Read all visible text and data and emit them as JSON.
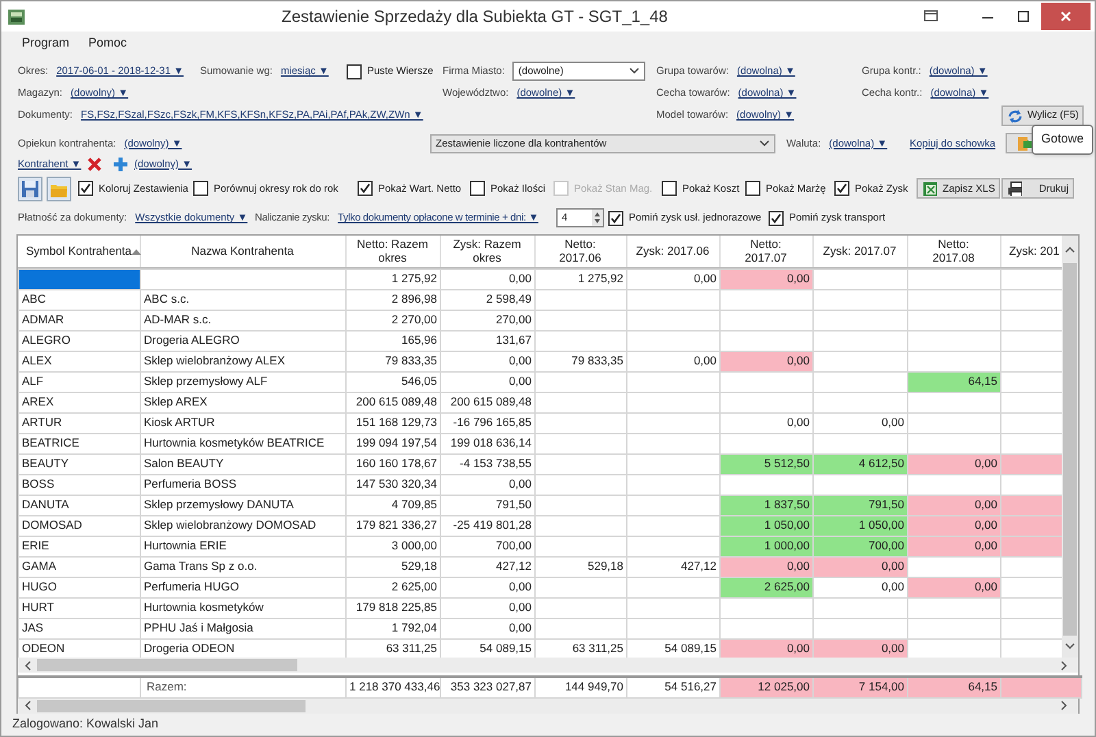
{
  "window": {
    "title": "Zestawienie Sprzedaży dla Subiekta GT - SGT_1_48"
  },
  "menu": [
    {
      "label": "Program"
    },
    {
      "label": "Pomoc"
    }
  ],
  "filter_rows": [
    {
      "items": [
        {
          "kind": "dropdown",
          "label": "Okres:",
          "value": "2017-06-01 - 2018-12-31 ▼"
        },
        {
          "kind": "dropdown",
          "label": "Sumowanie wg:",
          "value": "miesiąc ▼"
        },
        {
          "kind": "checkbox",
          "label": "Puste Wiersze",
          "checked": false
        },
        {
          "kind": "select",
          "label": "Firma Miasto:",
          "value": "(dowolne)"
        },
        {
          "kind": "dropdown",
          "label": "Grupa towarów:",
          "value": "(dowolna) ▼"
        },
        {
          "kind": "dropdown",
          "label": "Grupa kontr.:",
          "value": "(dowolna) ▼"
        }
      ]
    },
    {
      "items": [
        {
          "kind": "dropdown",
          "label": "Magazyn:",
          "value": "(dowolny) ▼"
        },
        {
          "kind": "dropdown",
          "label": "Województwo:",
          "value": "(dowolne) ▼"
        },
        {
          "kind": "dropdown",
          "label": "Cecha towarów:",
          "value": "(dowolna) ▼"
        },
        {
          "kind": "dropdown",
          "label": "Cecha kontr.:",
          "value": "(dowolna) ▼"
        }
      ]
    },
    {
      "items": [
        {
          "kind": "dropdown",
          "label": "Dokumenty:",
          "value": "FS,FSz,FSzal,FSzc,FSzk,FM,KFS,KFSn,KFSz,PA,PAi,PAf,PAk,ZW,ZWn ▼"
        },
        {
          "kind": "dropdown",
          "label": "Model towarów:",
          "value": "(dowolny) ▼"
        },
        {
          "kind": "button",
          "label": "Wylicz (F5)"
        }
      ]
    },
    {
      "items": [
        {
          "kind": "dropdown",
          "label": "Opiekun kontrahenta:",
          "value": "(dowolny) ▼"
        },
        {
          "kind": "select",
          "value": "Zestawienie liczone dla kontrahentów"
        },
        {
          "kind": "dropdown",
          "label": "Waluta:",
          "value": "(dowolna) ▼"
        },
        {
          "kind": "link",
          "value": "Kopiuj do schowka"
        },
        {
          "kind": "icon-button"
        }
      ]
    },
    {
      "items": [
        {
          "kind": "link",
          "value": "Kontrahent ▼"
        },
        {
          "kind": "icon-button"
        },
        {
          "kind": "icon-button"
        },
        {
          "kind": "link",
          "value": "(dowolny) ▼"
        }
      ]
    },
    {
      "items": [
        {
          "kind": "icon-button"
        },
        {
          "kind": "icon-button"
        },
        {
          "kind": "checkbox",
          "label": "Koloruj Zestawienia",
          "checked": true
        },
        {
          "kind": "checkbox",
          "label": "Porównuj okresy rok do rok",
          "checked": false
        },
        {
          "kind": "checkbox",
          "label": "Pokaż Wart. Netto",
          "checked": true
        },
        {
          "kind": "checkbox",
          "label": "Pokaż Ilości",
          "checked": false
        },
        {
          "kind": "checkbox",
          "label": "Pokaż Stan Mag.",
          "checked": false,
          "disabled": true
        },
        {
          "kind": "checkbox",
          "label": "Pokaż Koszt",
          "checked": false
        },
        {
          "kind": "checkbox",
          "label": "Pokaż Marżę",
          "checked": false
        },
        {
          "kind": "checkbox",
          "label": "Pokaż Zysk",
          "checked": true
        },
        {
          "kind": "button",
          "label": "Zapisz XLS"
        },
        {
          "kind": "button",
          "label": "Drukuj"
        }
      ]
    },
    {
      "items": [
        {
          "kind": "dropdown",
          "label": "Płatność za dokumenty:",
          "value": "Wszystkie dokumenty ▼"
        },
        {
          "kind": "dropdown",
          "label": "Naliczanie zysku:",
          "value": "Tylko dokumenty opłacone w terminie + dni: ▼"
        },
        {
          "kind": "spinner",
          "value": "4"
        },
        {
          "kind": "checkbox",
          "label": "Pomiń zysk usł. jednorazowe",
          "checked": true
        },
        {
          "kind": "checkbox",
          "label": "Pomiń zysk transport",
          "checked": true
        }
      ]
    }
  ],
  "tooltip": {
    "text": "Gotowe"
  },
  "table": {
    "columns": [
      {
        "label": "Symbol Kontrahenta",
        "sorted": true
      },
      {
        "label": "Nazwa Kontrahenta"
      },
      {
        "label": "Netto: Razem okres"
      },
      {
        "label": "Zysk: Razem okres"
      },
      {
        "label": "Netto: 2017.06"
      },
      {
        "label": "Zysk: 2017.06"
      },
      {
        "label": "Netto: 2017.07"
      },
      {
        "label": "Zysk: 2017.07"
      },
      {
        "label": "Netto: 2017.08"
      },
      {
        "label": "Zysk: 201"
      }
    ],
    "rows": [
      {
        "selected": true,
        "cells": [
          null,
          null,
          "1 275,92",
          "0,00",
          "1 275,92",
          "0,00",
          {
            "text": "0,00",
            "color": "#f9b6c0"
          },
          null,
          null,
          null
        ]
      },
      {
        "selected": false,
        "cells": [
          "ABC",
          "ABC s.c.",
          "2 896,98",
          "2 598,49",
          null,
          null,
          null,
          null,
          null,
          null
        ]
      },
      {
        "selected": false,
        "cells": [
          "ADMAR",
          "AD-MAR s.c.",
          "2 270,00",
          "270,00",
          null,
          null,
          null,
          null,
          null,
          null
        ]
      },
      {
        "selected": false,
        "cells": [
          "ALEGRO",
          "Drogeria ALEGRO",
          "165,96",
          "131,67",
          null,
          null,
          null,
          null,
          null,
          null
        ]
      },
      {
        "selected": false,
        "cells": [
          "ALEX",
          "Sklep wielobranżowy  ALEX",
          "79 833,35",
          "0,00",
          "79 833,35",
          "0,00",
          {
            "text": "0,00",
            "color": "#f9b6c0"
          },
          null,
          null,
          null
        ]
      },
      {
        "selected": false,
        "cells": [
          "ALF",
          "Sklep przemysłowy ALF",
          "546,05",
          "0,00",
          null,
          null,
          null,
          null,
          {
            "text": "64,15",
            "color": "#8fe38a"
          },
          null
        ]
      },
      {
        "selected": false,
        "cells": [
          "AREX",
          "Sklep AREX",
          "200 615 089,48",
          "200 615 089,48",
          null,
          null,
          null,
          null,
          null,
          null
        ]
      },
      {
        "selected": false,
        "cells": [
          "ARTUR",
          "Kiosk ARTUR",
          "151 168 129,73",
          "-16 796 165,85",
          null,
          null,
          "0,00",
          "0,00",
          null,
          null
        ]
      },
      {
        "selected": false,
        "cells": [
          "BEATRICE",
          "Hurtownia kosmetyków BEATRICE",
          "199 094 197,54",
          "199 018 636,14",
          null,
          null,
          null,
          null,
          null,
          null
        ]
      },
      {
        "selected": false,
        "cells": [
          "BEAUTY",
          "Salon BEAUTY",
          "160 160 178,67",
          "-4 153 738,55",
          null,
          null,
          {
            "text": "5 512,50",
            "color": "#8fe38a"
          },
          {
            "text": "4 612,50",
            "color": "#8fe38a"
          },
          {
            "text": "0,00",
            "color": "#f9b6c0"
          },
          {
            "color": "#f9b6c0"
          }
        ]
      },
      {
        "selected": false,
        "cells": [
          "BOSS",
          "Perfumeria BOSS",
          "147 530 320,34",
          "0,00",
          null,
          null,
          null,
          null,
          null,
          null
        ]
      },
      {
        "selected": false,
        "cells": [
          "DANUTA",
          "Sklep przemysłowy DANUTA",
          "4 709,85",
          "791,50",
          null,
          null,
          {
            "text": "1 837,50",
            "color": "#8fe38a"
          },
          {
            "text": "791,50",
            "color": "#8fe38a"
          },
          {
            "text": "0,00",
            "color": "#f9b6c0"
          },
          {
            "color": "#f9b6c0"
          }
        ]
      },
      {
        "selected": false,
        "cells": [
          "DOMOSAD",
          "Sklep wielobranżowy DOMOSAD",
          "179 821 336,27",
          "-25 419 801,28",
          null,
          null,
          {
            "text": "1 050,00",
            "color": "#8fe38a"
          },
          {
            "text": "1 050,00",
            "color": "#8fe38a"
          },
          {
            "text": "0,00",
            "color": "#f9b6c0"
          },
          {
            "color": "#f9b6c0"
          }
        ]
      },
      {
        "selected": false,
        "cells": [
          "ERIE",
          "Hurtownia ERIE",
          "3 000,00",
          "700,00",
          null,
          null,
          {
            "text": "1 000,00",
            "color": "#8fe38a"
          },
          {
            "text": "700,00",
            "color": "#8fe38a"
          },
          {
            "text": "0,00",
            "color": "#f9b6c0"
          },
          {
            "color": "#f9b6c0"
          }
        ]
      },
      {
        "selected": false,
        "cells": [
          "GAMA",
          "Gama Trans Sp z o.o.",
          "529,18",
          "427,12",
          "529,18",
          "427,12",
          {
            "text": "0,00",
            "color": "#f9b6c0"
          },
          {
            "text": "0,00",
            "color": "#f9b6c0"
          },
          null,
          null
        ]
      },
      {
        "selected": false,
        "cells": [
          "HUGO",
          "Perfumeria HUGO",
          "2 625,00",
          "0,00",
          null,
          null,
          {
            "text": "2 625,00",
            "color": "#8fe38a"
          },
          "0,00",
          {
            "text": "0,00",
            "color": "#f9b6c0"
          },
          null
        ]
      },
      {
        "selected": false,
        "cells": [
          "HURT",
          "Hurtownia kosmetyków",
          "179 818 225,85",
          "0,00",
          null,
          null,
          null,
          null,
          null,
          null
        ]
      },
      {
        "selected": false,
        "cells": [
          "JAS",
          "PPHU Jaś i Małgosia",
          "1 792,04",
          "0,00",
          null,
          null,
          null,
          null,
          null,
          null
        ]
      },
      {
        "selected": false,
        "cells": [
          "ODEON",
          "Drogeria ODEON",
          "63 311,25",
          "54 089,15",
          "63 311,25",
          "54 089,15",
          {
            "text": "0,00",
            "color": "#f9b6c0"
          },
          {
            "text": "0,00",
            "color": "#f9b6c0"
          },
          null,
          null
        ]
      }
    ],
    "totals": {
      "cells": [
        null,
        "Razem:",
        "1 218 370 433,46",
        "353 323 027,87",
        "144 949,70",
        "54 516,27",
        {
          "text": "12 025,00",
          "color": "#f9b6c0"
        },
        {
          "text": "7 154,00",
          "color": "#f9b6c0"
        },
        {
          "text": "64,15",
          "color": "#f9b6c0"
        },
        {
          "color": "#f9b6c0"
        }
      ]
    }
  },
  "status_bar": {
    "text": "Zalogowano: Kowalski Jan"
  }
}
